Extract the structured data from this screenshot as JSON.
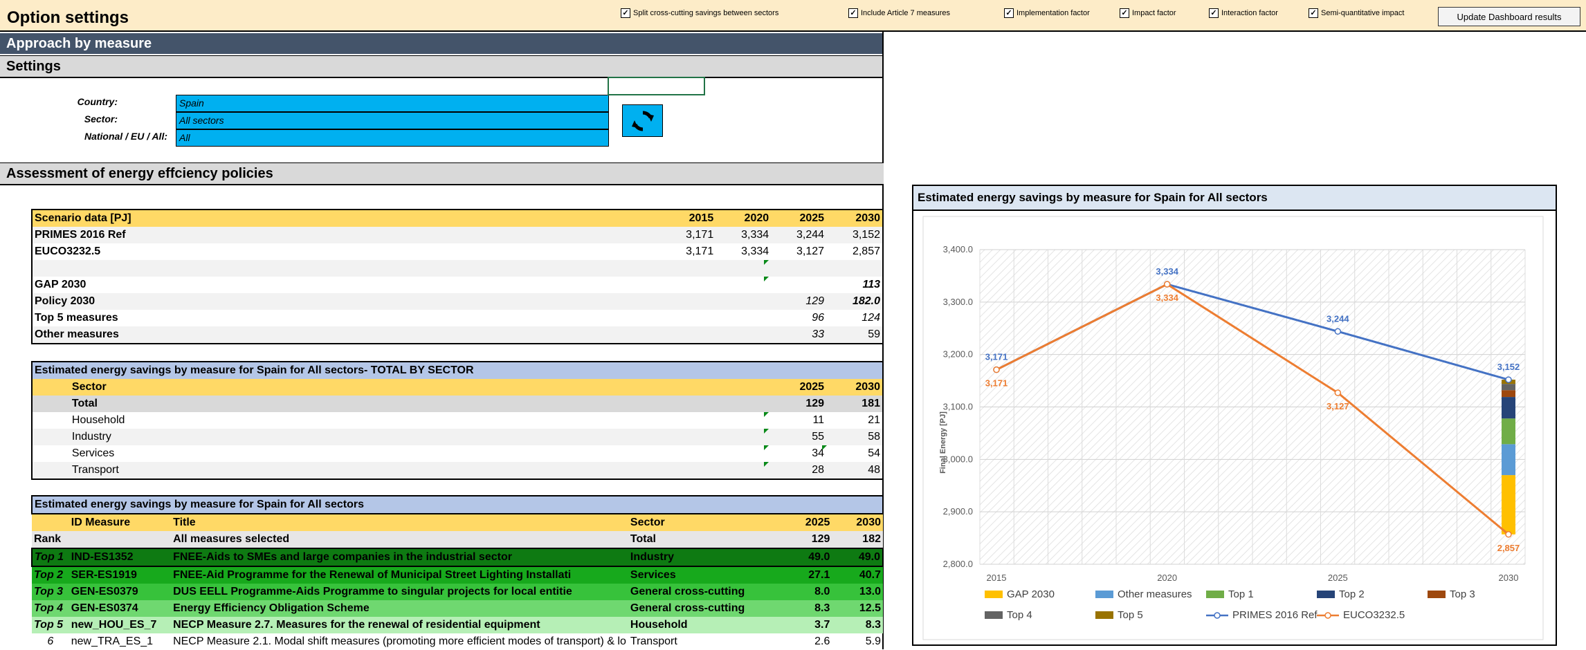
{
  "header": {
    "title": "Option settings",
    "checkboxes": [
      {
        "label": "Split cross-cutting savings between sectors",
        "checked": true
      },
      {
        "label": "Include Article 7 measures",
        "checked": true
      },
      {
        "label": "Implementation factor",
        "checked": true
      },
      {
        "label": "Impact factor",
        "checked": true
      },
      {
        "label": "Interaction factor",
        "checked": true
      },
      {
        "label": "Semi-quantitative impact",
        "checked": true
      }
    ],
    "update_button": "Update Dashboard results"
  },
  "sections": {
    "approach": "Approach by measure",
    "settings": "Settings",
    "assessment": "Assessment of energy effciency policies"
  },
  "settings": {
    "country_label": "Country:",
    "country_value": "Spain",
    "sector_label": "Sector:",
    "sector_value": "All sectors",
    "scope_label": "National / EU / All:",
    "scope_value": "All",
    "refresh_icon": "refresh-icon"
  },
  "scenario": {
    "header": {
      "label": "Scenario data [PJ]",
      "years": [
        "2015",
        "2020",
        "2025",
        "2030"
      ]
    },
    "rows": [
      {
        "label": "PRIMES 2016 Ref",
        "vals": [
          "3,171",
          "3,334",
          "3,244",
          "3,152"
        ]
      },
      {
        "label": "EUCO3232.5",
        "vals": [
          "3,171",
          "3,334",
          "3,127",
          "2,857"
        ]
      },
      {
        "label": "",
        "vals": [
          "",
          "",
          "",
          ""
        ]
      },
      {
        "label": "GAP 2030",
        "vals": [
          "",
          "",
          "",
          "113"
        ]
      },
      {
        "label": "Policy 2030",
        "vals": [
          "",
          "",
          "129",
          "182.0"
        ]
      },
      {
        "label": "Top 5 measures",
        "vals": [
          "",
          "",
          "96",
          "124"
        ]
      },
      {
        "label": "Other measures",
        "vals": [
          "",
          "",
          "33",
          "59"
        ]
      }
    ]
  },
  "by_sector": {
    "title": "Estimated energy savings by measure for Spain for All sectors- TOTAL BY SECTOR",
    "header": {
      "label": "Sector",
      "y1": "2025",
      "y2": "2030"
    },
    "total": {
      "label": "Total",
      "y1": "129",
      "y2": "181"
    },
    "rows": [
      {
        "label": "Household",
        "y1": "11",
        "y2": "21"
      },
      {
        "label": "Industry",
        "y1": "55",
        "y2": "58"
      },
      {
        "label": "Services",
        "y1": "34",
        "y2": "54"
      },
      {
        "label": "Transport",
        "y1": "28",
        "y2": "48"
      }
    ]
  },
  "by_measure": {
    "title": "Estimated energy savings by measure for Spain for All sectors",
    "header": {
      "id": "ID Measure",
      "title": "Title",
      "sector": "Sector",
      "y1": "2025",
      "y2": "2030"
    },
    "summary": {
      "rank": "Rank",
      "title": "All measures selected",
      "sector": "Total",
      "y1": "129",
      "y2": "182"
    },
    "rows": [
      {
        "rank": "Top 1",
        "id": "IND-ES1352",
        "title": "FNEE-Aids to SMEs and large companies in the industrial sector",
        "sector": "Industry",
        "y1": "49.0",
        "y2": "49.0"
      },
      {
        "rank": "Top 2",
        "id": "SER-ES1919",
        "title": "FNEE-Aid Programme for the Renewal of Municipal Street Lighting Installati",
        "sector": "Services",
        "y1": "27.1",
        "y2": "40.7"
      },
      {
        "rank": "Top 3",
        "id": "GEN-ES0379",
        "title": "DUS EELL Programme-Aids Programme to singular projects for local entitie",
        "sector": "General cross-cutting",
        "y1": "8.0",
        "y2": "13.0"
      },
      {
        "rank": "Top 4",
        "id": "GEN-ES0374",
        "title": "Energy Efficiency Obligation Scheme",
        "sector": "General cross-cutting",
        "y1": "8.3",
        "y2": "12.5"
      },
      {
        "rank": "Top 5",
        "id": "new_HOU_ES_7",
        "title": "NECP Measure 2.7. Measures for the renewal of residential equipment",
        "sector": "Household",
        "y1": "3.7",
        "y2": "8.3"
      },
      {
        "rank": "6",
        "id": "new_TRA_ES_1",
        "title": "NECP Measure 2.1. Modal shift measures (promoting more efficient modes of transport) & lo",
        "sector": "Transport",
        "y1": "2.6",
        "y2": "5.9"
      }
    ]
  },
  "chart": {
    "title": "Estimated energy savings by measure for Spain for All sectors",
    "ylabel": "Final Energy [PJ]"
  },
  "chart_data": {
    "type": "line",
    "x": [
      "2015",
      "2020",
      "2025",
      "2030"
    ],
    "ylim": [
      2800,
      3400
    ],
    "yticks": [
      "3,400.0",
      "3,300.0",
      "3,200.0",
      "3,100.0",
      "3,000.0",
      "2,900.0",
      "2,800.0"
    ],
    "ytick_values": [
      3400,
      3300,
      3200,
      3100,
      3000,
      2900,
      2800
    ],
    "ylabel": "Final Energy [PJ]",
    "grid": true,
    "legend_position": "bottom",
    "series": [
      {
        "name": "PRIMES 2016 Ref",
        "color": "#4472c4",
        "values": [
          3171,
          3334,
          3244,
          3152
        ],
        "labels": [
          "3,171",
          "3,334",
          "3,244",
          "3,152"
        ]
      },
      {
        "name": "EUCO3232.5",
        "color": "#ed7d31",
        "values": [
          3171,
          3334,
          3127,
          2857
        ],
        "labels": [
          "3,171",
          "3,334",
          "3,127",
          "2,857"
        ]
      }
    ],
    "stack_2030": {
      "base": 2857,
      "segments": [
        {
          "name": "GAP 2030",
          "color": "#ffc000",
          "value": 113
        },
        {
          "name": "Other measures",
          "color": "#5b9bd5",
          "value": 59
        },
        {
          "name": "Top 1",
          "color": "#70ad47",
          "value": 49
        },
        {
          "name": "Top 2",
          "color": "#264478",
          "value": 41
        },
        {
          "name": "Top 3",
          "color": "#9e480e",
          "value": 13
        },
        {
          "name": "Top 4",
          "color": "#636363",
          "value": 12
        },
        {
          "name": "Top 5",
          "color": "#997300",
          "value": 8
        }
      ]
    },
    "legend": [
      "GAP 2030",
      "Other measures",
      "Top 1",
      "Top 2",
      "Top 3",
      "Top 4",
      "Top 5",
      "PRIMES 2016 Ref",
      "EUCO3232.5"
    ]
  }
}
